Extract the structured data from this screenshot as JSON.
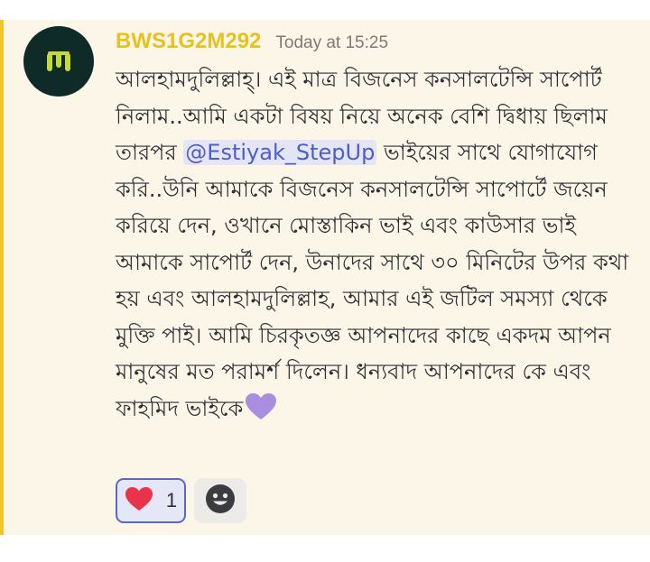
{
  "message": {
    "username": "BWS1G2M292",
    "timestamp": "Today at 15:25",
    "text_before_mention": "আলহামদুলিল্লাহ্।  এই মাত্র বিজনেস কনসালটেন্সি সাপোর্ট নিলাম..আমি একটা বিষয় নিয়ে অনেক বেশি দ্বিধায় ছিলাম তারপর ",
    "mention": "@Estiyak_StepUp",
    "text_after_mention": " ভাইয়ের সাথে যোগাযোগ করি..উনি আমাকে বিজনেস কনসালটেন্সি সাপোর্টে জয়েন করিয়ে দেন, ওখানে মোস্তাকিন ভাই এবং কাউসার ভাই আমাকে সাপোর্ট দেন, উনাদের সাথে ৩০ মিনিটের উপর কথা হয় এবং আলহামদুলিল্লাহ, আমার এই জটিল সমস্যা থেকে মুক্তি পাই। আমি চিরকৃতজ্ঞ আপনাদের কাছে একদম আপন মানুষের মত পরামর্শ দিলেন। ধন্যবাদ আপনাদের কে এবং ফাহমিদ ভাইকে",
    "inline_emoji": "purple-heart-icon",
    "avatar_icon": "tally-logo-icon"
  },
  "reactions": [
    {
      "emoji": "heart-icon",
      "count": "1",
      "selected": true
    }
  ],
  "add_reaction_icon": "smiley-add-reaction-icon",
  "colors": {
    "username": "#e6c120",
    "accent_bar": "#f0c42a",
    "message_bg": "#fcf6e9",
    "mention_text": "#4f5dc6",
    "mention_bg": "#e4e6f6",
    "reaction_border": "#5b68c8",
    "heart": "#e8334a",
    "purple_heart": "#a98ee0",
    "avatar_bg": "#0f2b28",
    "avatar_logo": "#c6d93a"
  }
}
